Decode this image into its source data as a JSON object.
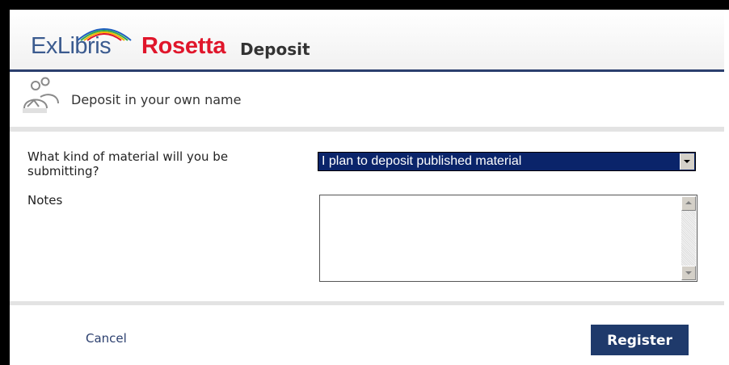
{
  "app": {
    "brand_ex": "ExLibris",
    "brand_rosetta": "Rosetta",
    "brand_deposit": "Deposit"
  },
  "subheader": {
    "icon": "users-icon",
    "title": "Deposit in your own name"
  },
  "form": {
    "material_question": "What kind of material will you be submitting?",
    "material_selected": "I plan to deposit published material",
    "notes_label": "Notes",
    "notes_value": ""
  },
  "footer": {
    "cancel_label": "Cancel",
    "register_label": "Register"
  },
  "colors": {
    "brand_blue": "#3b5b8f",
    "brand_red": "#e0162b",
    "accent_navy": "#1f3a6b",
    "select_highlight": "#0a246a"
  }
}
